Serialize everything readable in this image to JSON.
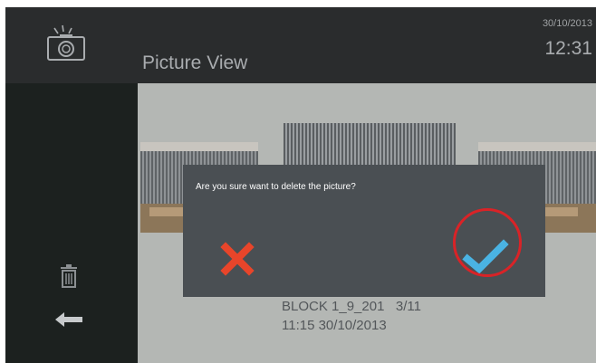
{
  "header": {
    "title": "Picture View",
    "date": "30/10/2013",
    "time": "12:31",
    "camera_icon": "camera-icon"
  },
  "sidebar": {
    "delete_icon": "trash-icon",
    "back_icon": "arrow-left-icon"
  },
  "gallery": {
    "caption_line1": "BLOCK 1_9_201   3/11",
    "caption_line2": "11:15 30/10/2013"
  },
  "dialog": {
    "message": "Are you sure want to delete the picture?",
    "cancel_icon": "x-icon",
    "confirm_icon": "checkmark-icon"
  },
  "colors": {
    "header_bg": "#2a2c2d",
    "sidebar_bg": "#1c211f",
    "dialog_bg": "#4a4f53",
    "cancel": "#e8452a",
    "confirm": "#4ab3e3",
    "highlight_ring": "#d92327"
  }
}
